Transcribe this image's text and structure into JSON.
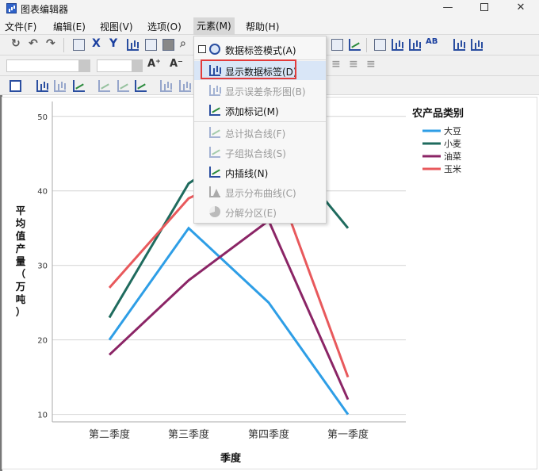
{
  "window": {
    "title": "图表编辑器",
    "minimize": "—",
    "close": "✕"
  },
  "menu": [
    {
      "label": "文件(F)"
    },
    {
      "label": "编辑(E)"
    },
    {
      "label": "视图(V)"
    },
    {
      "label": "选项(O)"
    },
    {
      "label": "元素(M)"
    },
    {
      "label": "帮助(H)"
    }
  ],
  "toolbar": {
    "font_up": "A⁺",
    "font_down": "A⁻",
    "x_label": "X",
    "y_label": "Y"
  },
  "dropdown": {
    "items": [
      {
        "label": "数据标签模式(A)",
        "enabled": true,
        "icon": "data-label-mode-icon"
      },
      {
        "label": "显示数据标签(D)",
        "enabled": true,
        "icon": "bar-chart-icon",
        "highlighted": true
      },
      {
        "label": "显示误差条形图(B)",
        "enabled": false,
        "icon": "error-bar-icon"
      },
      {
        "label": "添加标记(M)",
        "enabled": true,
        "icon": "marker-icon"
      },
      {
        "label": "总计拟合线(F)",
        "enabled": false,
        "icon": "fit-line-icon"
      },
      {
        "label": "子组拟合线(S)",
        "enabled": false,
        "icon": "subgroup-fit-icon"
      },
      {
        "label": "内插线(N)",
        "enabled": true,
        "icon": "interpolation-line-icon"
      },
      {
        "label": "显示分布曲线(C)",
        "enabled": false,
        "icon": "distribution-curve-icon"
      },
      {
        "label": "分解分区(E)",
        "enabled": false,
        "icon": "explode-slice-icon"
      }
    ]
  },
  "chart_data": {
    "type": "line",
    "categories": [
      "第二季度",
      "第三季度",
      "第四季度",
      "第一季度"
    ],
    "xlabel": "季度",
    "ylabel": "平均值产量（万吨）",
    "yticks": [
      10,
      20,
      30,
      40,
      50
    ],
    "ylim": [
      9,
      52
    ],
    "legend_title": "农产品类别",
    "legend_position": "right",
    "grid": "horizontal",
    "series": [
      {
        "name": "大豆",
        "color": "#2e9ee6",
        "values": [
          20,
          35,
          25,
          10
        ]
      },
      {
        "name": "小麦",
        "color": "#1f6b5e",
        "values": [
          23,
          41,
          48,
          35
        ]
      },
      {
        "name": "油菜",
        "color": "#8b2566",
        "values": [
          18,
          28,
          36,
          12
        ]
      },
      {
        "name": "玉米",
        "color": "#e8595c",
        "values": [
          27,
          39,
          44,
          15
        ]
      }
    ]
  }
}
